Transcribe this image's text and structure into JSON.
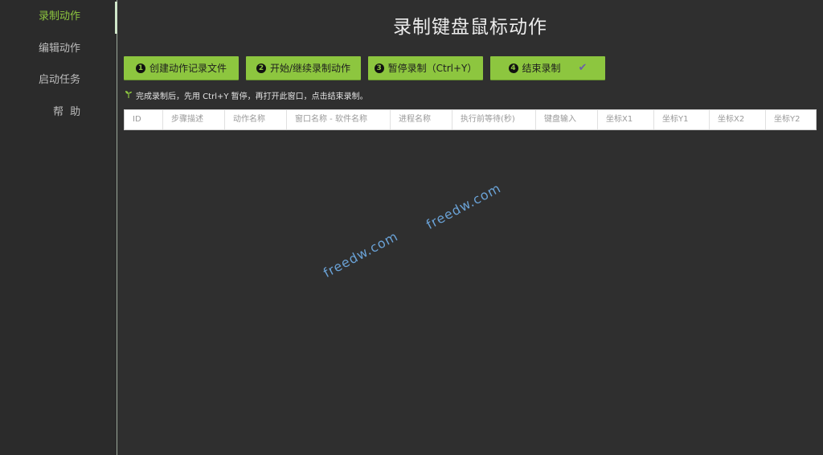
{
  "sidebar": {
    "items": [
      {
        "label": "录制动作",
        "active": true
      },
      {
        "label": "编辑动作",
        "active": false
      },
      {
        "label": "启动任务",
        "active": false
      },
      {
        "label": "帮 助",
        "active": false
      }
    ]
  },
  "header": {
    "title": "录制键盘鼠标动作"
  },
  "toolbar": {
    "buttons": [
      {
        "num": "1",
        "label": "创建动作记录文件"
      },
      {
        "num": "2",
        "label": "开始/继续录制动作"
      },
      {
        "num": "3",
        "label": "暂停录制（Ctrl+Y）"
      },
      {
        "num": "4",
        "label": "结束录制",
        "icon": "check-icon",
        "icon_glyph": "✔"
      }
    ]
  },
  "hint": {
    "icon": "sprout-icon",
    "text": "完成录制后，先用 Ctrl+Y 暂停，再打开此窗口，点击结束录制。"
  },
  "table": {
    "columns": [
      "ID",
      "步骤描述",
      "动作名称",
      "窗口名称 - 软件名称",
      "进程名称",
      "执行前等待(秒)",
      "键盘输入",
      "坐标X1",
      "坐标Y1",
      "坐标X2",
      "坐标Y2"
    ],
    "rows": []
  },
  "watermark": {
    "text1": "freedw.com",
    "text2": "freedw.com"
  },
  "colors": {
    "accent": "#8dc63f",
    "background": "#2f2f2f",
    "sidebar_bg": "#2b2b2b",
    "watermark": "#6aa2d6"
  }
}
